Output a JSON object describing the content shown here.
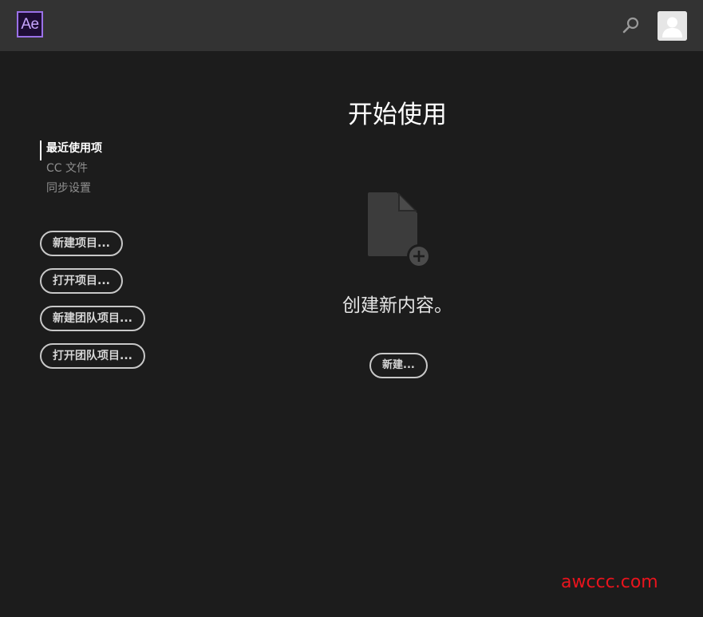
{
  "app": {
    "logo_text": "Ae",
    "brand_color": "#9b71e8"
  },
  "header": {
    "search_icon": "search-icon",
    "avatar_icon": "user-avatar-icon"
  },
  "sidebar": {
    "nav": [
      {
        "label": "最近使用项",
        "active": true
      },
      {
        "label": "CC 文件",
        "active": false
      },
      {
        "label": "同步设置",
        "active": false
      }
    ],
    "buttons": [
      {
        "label": "新建项目..."
      },
      {
        "label": "打开项目..."
      },
      {
        "label": "新建团队项目..."
      },
      {
        "label": "打开团队项目..."
      }
    ]
  },
  "main": {
    "title": "开始使用",
    "empty_icon": "new-document-icon",
    "message": "创建新内容。",
    "new_button_label": "新建..."
  },
  "watermark": {
    "text": "awccc.com",
    "color": "#e8141d"
  }
}
